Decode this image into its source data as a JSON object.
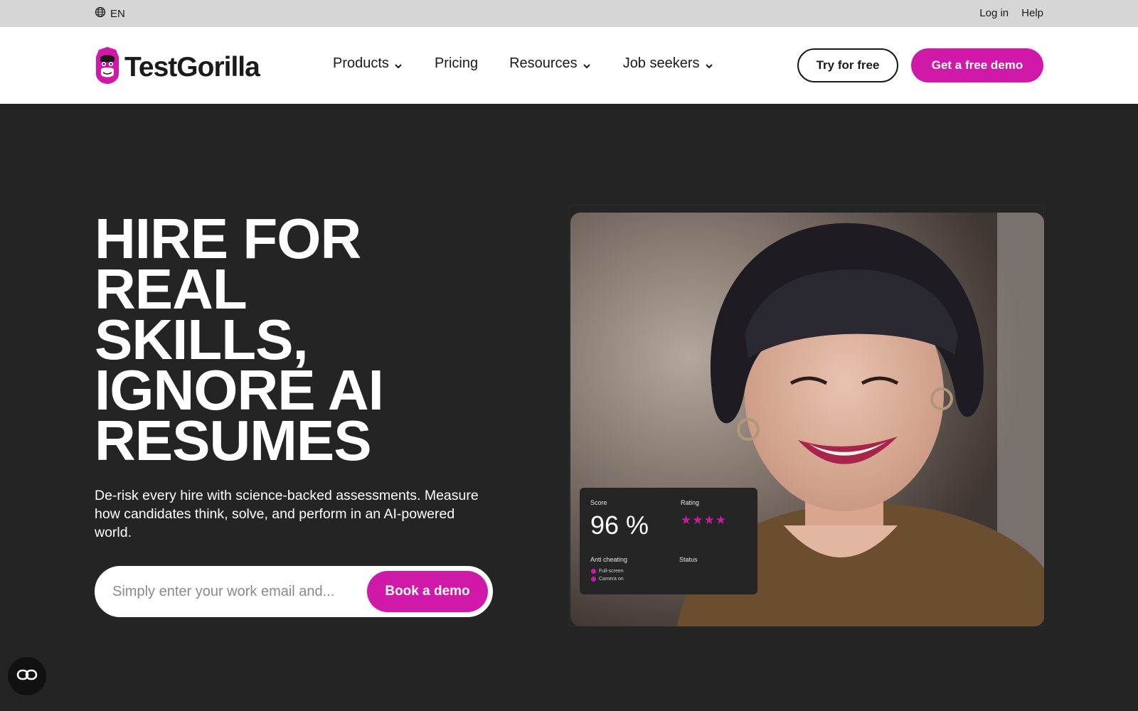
{
  "utility": {
    "language": "EN",
    "links": [
      {
        "label": "Log in"
      },
      {
        "label": "Help"
      }
    ]
  },
  "brand": {
    "name": "TestGorilla",
    "color": "#d119a9"
  },
  "nav": {
    "items": [
      {
        "label": "Products",
        "has_dropdown": true
      },
      {
        "label": "Pricing",
        "has_dropdown": false
      },
      {
        "label": "Resources",
        "has_dropdown": true
      },
      {
        "label": "Job seekers",
        "has_dropdown": true
      }
    ],
    "try_free": "Try for free",
    "get_demo": "Get a free demo"
  },
  "hero": {
    "title_lines": [
      "HIRE FOR",
      "REAL",
      "SKILLS,",
      "IGNORE AI",
      "RESUMES"
    ],
    "subtitle": "De-risk every hire with science-backed assessments. Measure how candidates think, solve, and perform in an AI-powered world.",
    "email_placeholder": "Simply enter your work email and...",
    "cta": "Book a demo"
  },
  "score_card": {
    "score_label": "Score",
    "score_value": "96 %",
    "rating_label": "Rating",
    "rating_stars": 4,
    "anti_cheating_label": "Anti cheating",
    "status_label": "Status",
    "checks": [
      "Full-screen",
      "Camera on"
    ]
  },
  "icons": {
    "language": "globe-icon",
    "dropdown": "chevron-down-icon",
    "accessibility": "accessibility-icon"
  }
}
